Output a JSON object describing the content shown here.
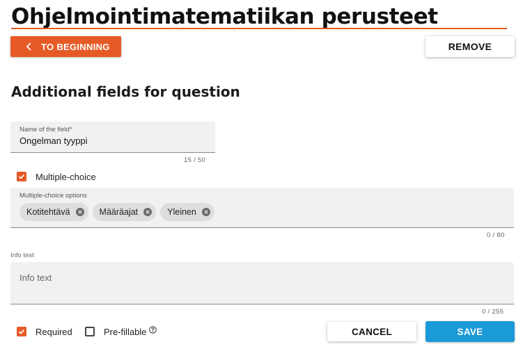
{
  "course_title": "Ohjelmointimatematiikan perusteet",
  "toolbar": {
    "back_label": "TO BEGINNING",
    "remove_label": "REMOVE"
  },
  "section_title": "Additional fields for question",
  "field_name": {
    "label": "Name of the field*",
    "value": "Ongelman tyyppi",
    "counter": "15 / 50"
  },
  "multiple_choice": {
    "label": "Multiple-choice",
    "checked": true
  },
  "options_field": {
    "label": "Multiple-choice options",
    "chips": [
      "Kotitehtävä",
      "Määräajat",
      "Yleinen"
    ],
    "counter": "0 / 80"
  },
  "info_text": {
    "label": "Info text",
    "placeholder": "Info text",
    "counter": "0 / 255"
  },
  "required": {
    "label": "Required",
    "checked": true
  },
  "prefillable": {
    "label": "Pre-fillable",
    "checked": false
  },
  "actions": {
    "cancel_label": "CANCEL",
    "save_label": "SAVE"
  },
  "colors": {
    "accent": "#e65a26",
    "save": "#1a9ad6"
  }
}
